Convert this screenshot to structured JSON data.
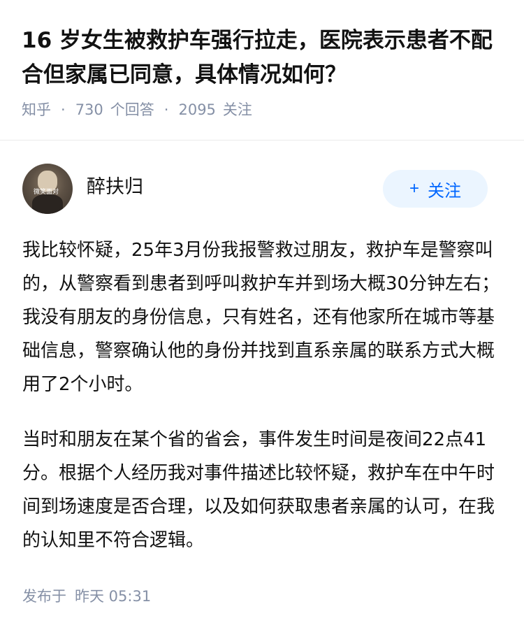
{
  "question": {
    "title": "16 岁女生被救护车强行拉走，医院表示患者不配合但家属已同意，具体情况如何？",
    "source": "知乎",
    "answer_count": "730",
    "answer_label": "个回答",
    "follower_count": "2095",
    "follower_label": "关注"
  },
  "answer": {
    "author": {
      "name": "醉扶归",
      "avatar_caption": "微笑面对"
    },
    "follow_button": {
      "icon": "+",
      "label": "关注"
    },
    "paragraphs": [
      "我比较怀疑，25年3月份我报警救过朋友，救护车是警察叫的，从警察看到患者到呼叫救护车并到场大概30分钟左右；我没有朋友的身份信息，只有姓名，还有他家所在城市等基础信息，警察确认他的身份并找到直系亲属的联系方式大概用了2个小时。",
      "当时和朋友在某个省的省会，事件发生时间是夜间22点41分。根据个人经历我对事件描述比较怀疑，救护车在中午时间到场速度是否合理，以及如何获取患者亲属的认可，在我的认知里不符合逻辑。"
    ],
    "publish_label": "发布于",
    "publish_time": "昨天 05:31"
  },
  "colors": {
    "text": "#121212",
    "muted": "#8590a6",
    "accent": "#0066ff",
    "button_bg": "#ebf5ff"
  }
}
